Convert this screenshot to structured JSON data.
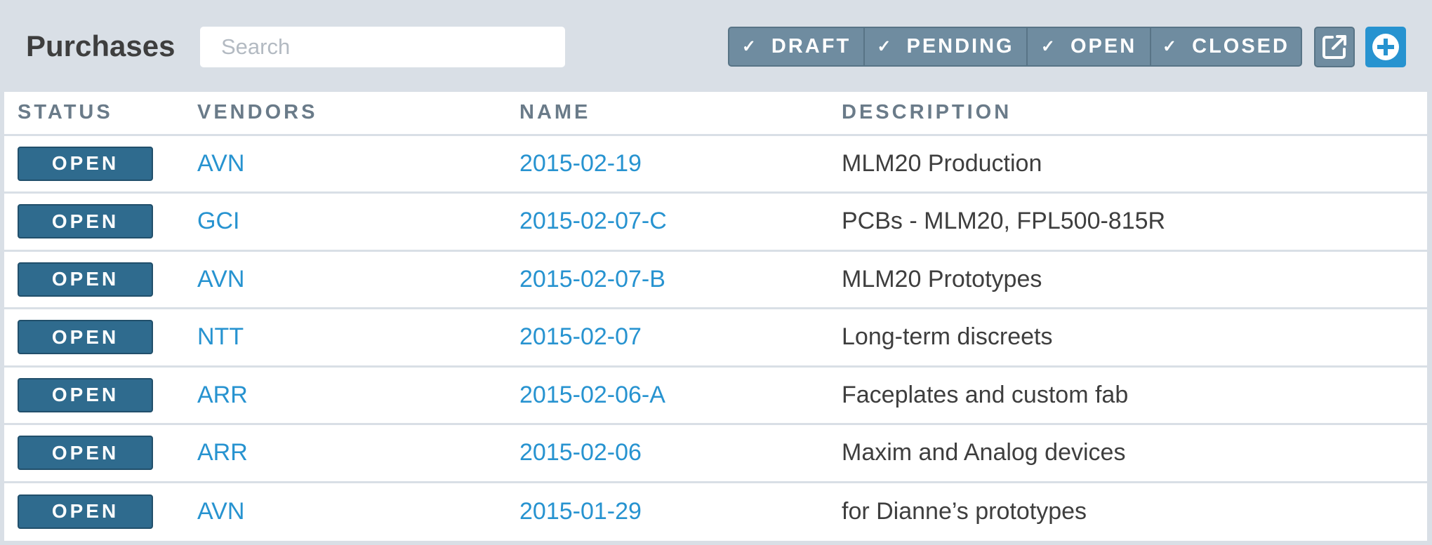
{
  "header": {
    "title": "Purchases",
    "search": {
      "placeholder": "Search",
      "value": ""
    },
    "filters": [
      {
        "label": "DRAFT",
        "checked": true
      },
      {
        "label": "PENDING",
        "checked": true
      },
      {
        "label": "OPEN",
        "checked": true
      },
      {
        "label": "CLOSED",
        "checked": true
      }
    ],
    "check_glyph": "✓",
    "export_icon": "external-link-icon",
    "add_icon": "plus-circle-icon"
  },
  "table": {
    "columns": [
      "STATUS",
      "VENDORS",
      "NAME",
      "DESCRIPTION"
    ],
    "rows": [
      {
        "status": "OPEN",
        "vendor": "AVN",
        "name": "2015-02-19",
        "description": "MLM20 Production"
      },
      {
        "status": "OPEN",
        "vendor": "GCI",
        "name": "2015-02-07-C",
        "description": "PCBs - MLM20, FPL500-815R"
      },
      {
        "status": "OPEN",
        "vendor": "AVN",
        "name": "2015-02-07-B",
        "description": "MLM20 Prototypes"
      },
      {
        "status": "OPEN",
        "vendor": "NTT",
        "name": "2015-02-07",
        "description": "Long-term discreets"
      },
      {
        "status": "OPEN",
        "vendor": "ARR",
        "name": "2015-02-06-A",
        "description": "Faceplates and custom fab"
      },
      {
        "status": "OPEN",
        "vendor": "ARR",
        "name": "2015-02-06",
        "description": "Maxim and Analog devices"
      },
      {
        "status": "OPEN",
        "vendor": "AVN",
        "name": "2015-01-29",
        "description": "for Dianne’s prototypes"
      }
    ]
  },
  "colors": {
    "background": "#d9dfe6",
    "filter_bg": "#6f8ca0",
    "badge_bg": "#2f6b8e",
    "link": "#2793d0",
    "add_button": "#2793d0"
  }
}
